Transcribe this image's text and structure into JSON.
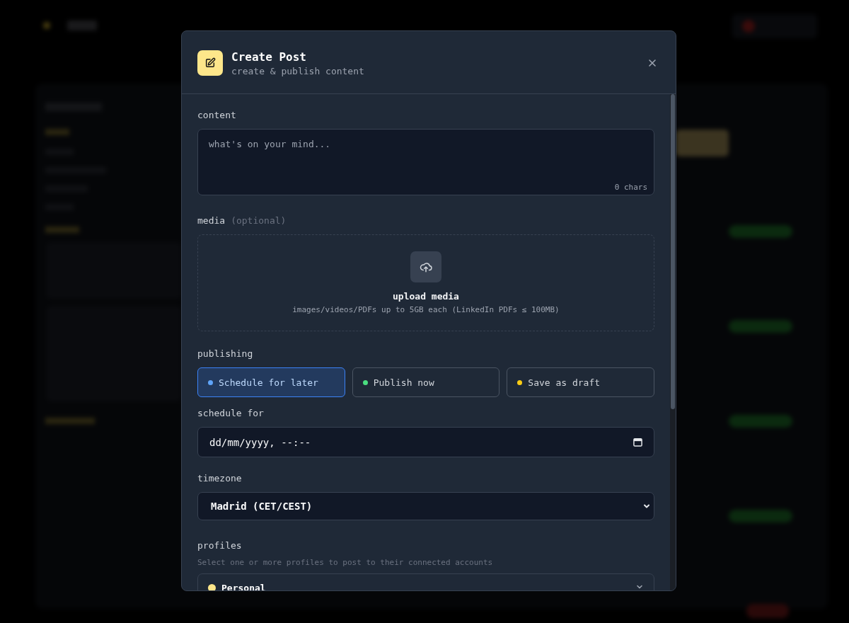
{
  "header": {
    "title": "Create Post",
    "subtitle": "create & publish content"
  },
  "content": {
    "label": "content",
    "placeholder": "what's on your mind...",
    "counter": "0 chars"
  },
  "media": {
    "label": "media",
    "hint": "(optional)",
    "upload_title": "upload media",
    "upload_note": "images/videos/PDFs up to 5GB each (LinkedIn PDFs ≤ 100MB)"
  },
  "publishing": {
    "label": "publishing",
    "options": [
      {
        "label": "Schedule for later",
        "selected": true,
        "color": "#60a5fa"
      },
      {
        "label": "Publish now",
        "selected": false,
        "color": "#4ade80"
      },
      {
        "label": "Save as draft",
        "selected": false,
        "color": "#facc15"
      }
    ]
  },
  "schedule": {
    "label": "schedule for",
    "value": "dd/mm/yyyy, --:--"
  },
  "timezone": {
    "label": "timezone",
    "value": "Madrid (CET/CEST)"
  },
  "profiles": {
    "label": "profiles",
    "hint": "Select one or more profiles to post to their connected accounts",
    "selected_profile": {
      "name": "Personal",
      "color": "#fde68a"
    }
  }
}
